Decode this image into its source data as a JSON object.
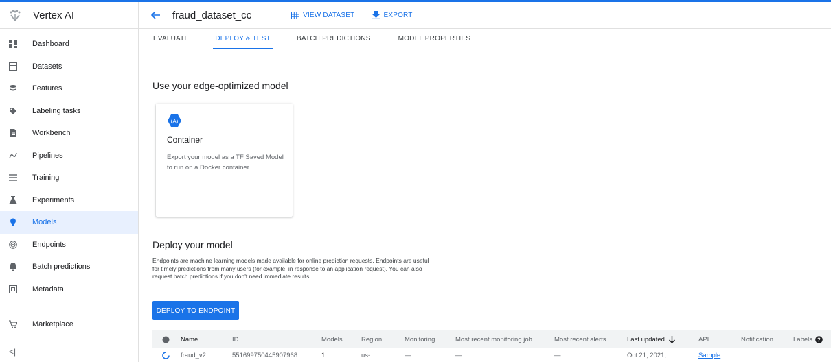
{
  "app": {
    "title": "Vertex AI"
  },
  "sidebar": {
    "items": [
      {
        "label": "Dashboard",
        "icon": "dashboard-icon"
      },
      {
        "label": "Datasets",
        "icon": "datasets-icon"
      },
      {
        "label": "Features",
        "icon": "features-icon"
      },
      {
        "label": "Labeling tasks",
        "icon": "label-icon"
      },
      {
        "label": "Workbench",
        "icon": "workbench-icon"
      },
      {
        "label": "Pipelines",
        "icon": "pipelines-icon"
      },
      {
        "label": "Training",
        "icon": "training-icon"
      },
      {
        "label": "Experiments",
        "icon": "experiments-icon"
      },
      {
        "label": "Models",
        "icon": "models-icon",
        "active": true
      },
      {
        "label": "Endpoints",
        "icon": "endpoints-icon"
      },
      {
        "label": "Batch predictions",
        "icon": "batch-predictions-icon"
      },
      {
        "label": "Metadata",
        "icon": "metadata-icon"
      }
    ],
    "marketplace": {
      "label": "Marketplace",
      "icon": "marketplace-icon"
    },
    "collapse_glyph": "<|"
  },
  "header": {
    "title": "fraud_dataset_cc",
    "view_dataset": "VIEW DATASET",
    "export": "EXPORT"
  },
  "tabs": [
    "EVALUATE",
    "DEPLOY & TEST",
    "BATCH PREDICTIONS",
    "MODEL PROPERTIES"
  ],
  "edge": {
    "title": "Use your edge-optimized model",
    "card": {
      "title": "Container",
      "description": "Export your model as a TF Saved Model to run on a Docker container."
    }
  },
  "deploy": {
    "title": "Deploy your model",
    "description": "Endpoints are machine learning models made available for online prediction requests. Endpoints are useful for timely predictions from many users (for example, in response to an application request). You can also request batch predictions if you don't need immediate results.",
    "button": "DEPLOY TO ENDPOINT"
  },
  "table": {
    "columns": {
      "name": "Name",
      "id": "ID",
      "models": "Models",
      "region": "Region",
      "monitoring": "Monitoring",
      "recent_job": "Most recent monitoring job",
      "recent_alerts": "Most recent alerts",
      "last_updated": "Last updated",
      "api": "API",
      "notification": "Notification",
      "labels": "Labels"
    },
    "rows": [
      {
        "name": "fraud_v2",
        "id": "5516997504459079​68",
        "models": "1",
        "region": "us-",
        "monitoring": "—",
        "recent_job": "—",
        "recent_alerts": "—",
        "last_updated": "Oct 21, 2021,",
        "api": "Sample"
      }
    ]
  },
  "colors": {
    "accent": "#1a73e8",
    "active_bg": "#e8f0fe"
  }
}
